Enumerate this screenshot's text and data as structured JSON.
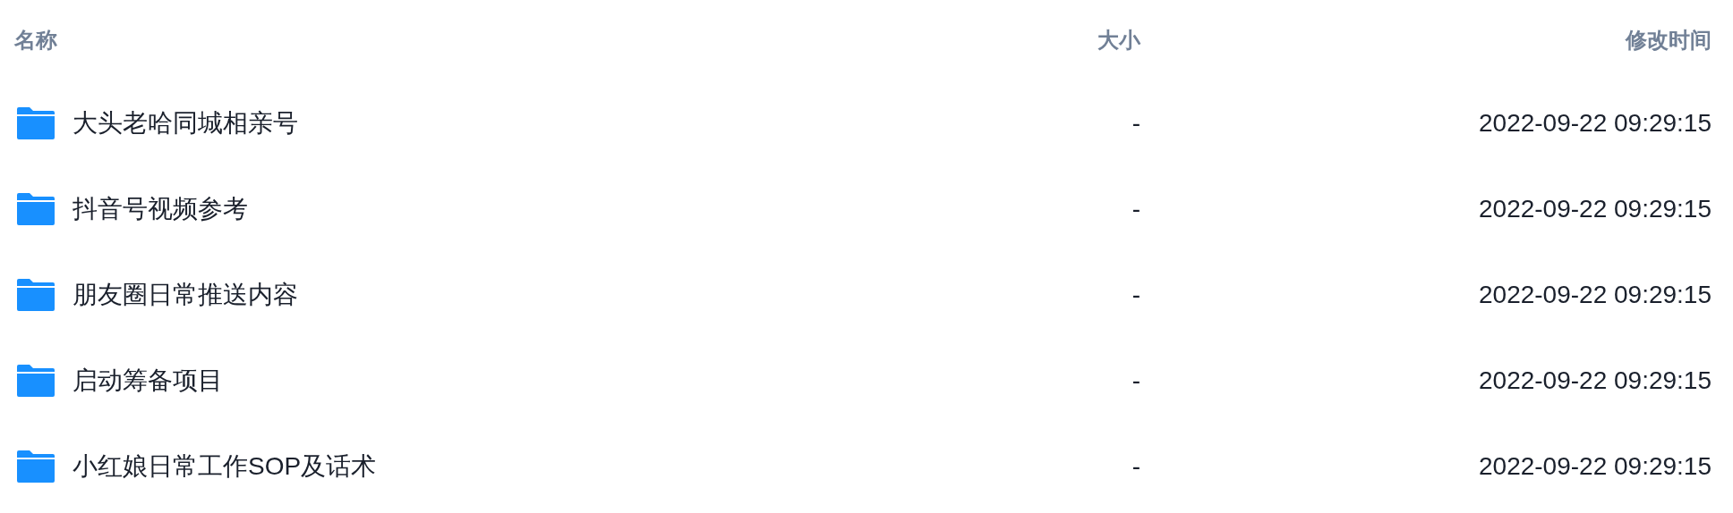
{
  "table": {
    "columns": [
      "名称",
      "大小",
      "修改时间"
    ],
    "rows": [
      {
        "kind": "folder",
        "name": "大头老哈同城相亲号",
        "size": "-",
        "modified": "2022-09-22 09:29:15"
      },
      {
        "kind": "folder",
        "name": "抖音号视频参考",
        "size": "-",
        "modified": "2022-09-22 09:29:15"
      },
      {
        "kind": "folder",
        "name": "朋友圈日常推送内容",
        "size": "-",
        "modified": "2022-09-22 09:29:15"
      },
      {
        "kind": "folder",
        "name": "启动筹备项目",
        "size": "-",
        "modified": "2022-09-22 09:29:15"
      },
      {
        "kind": "folder",
        "name": "小红娘日常工作SOP及话术",
        "size": "-",
        "modified": "2022-09-22 09:29:15"
      }
    ]
  }
}
